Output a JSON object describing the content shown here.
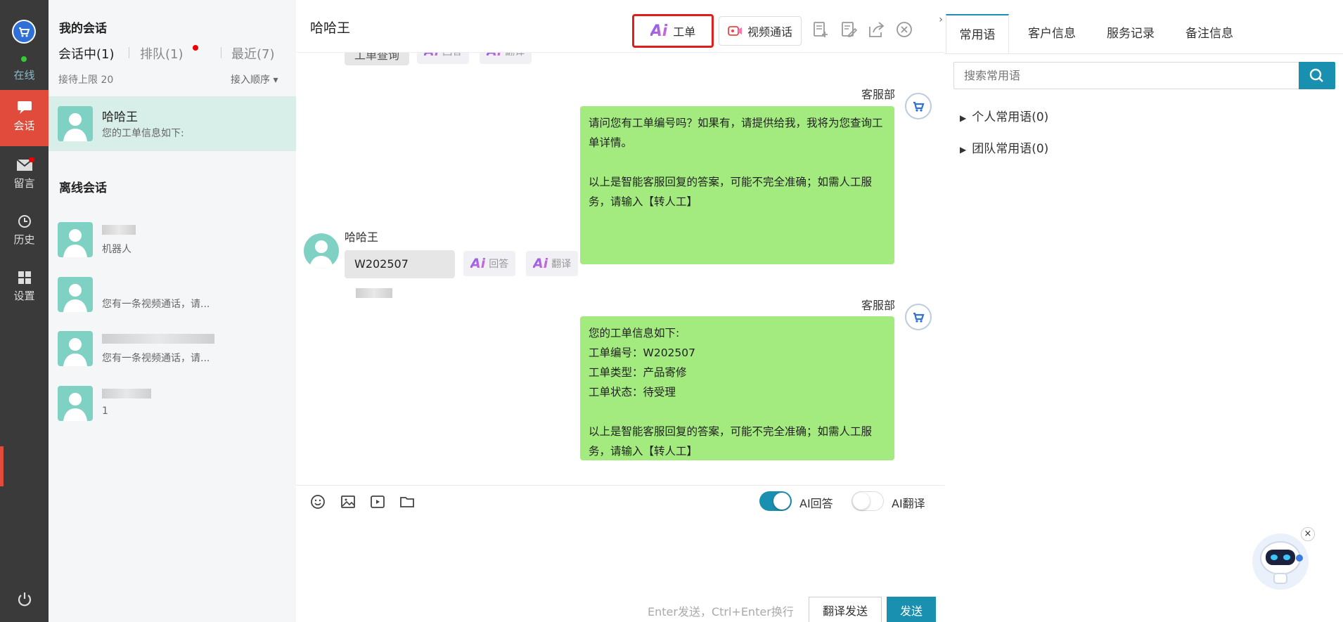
{
  "rail": {
    "status": "在线",
    "items": [
      {
        "label": "会话",
        "icon": "chat-icon"
      },
      {
        "label": "留言",
        "icon": "mail-icon"
      },
      {
        "label": "历史",
        "icon": "clock-icon"
      },
      {
        "label": "设置",
        "icon": "grid-icon"
      }
    ]
  },
  "list": {
    "my_title": "我的会话",
    "tabs": [
      "会话中(1)",
      "排队(1)",
      "最近(7)"
    ],
    "limit": "接待上限 20",
    "order": "接入顺序",
    "active_conv": {
      "name": "哈哈王",
      "msg": "您的工单信息如下:"
    },
    "offline_title": "离线会话",
    "offline": [
      {
        "name": "",
        "msg": "机器人"
      },
      {
        "name": "",
        "msg": "您有一条视频通话，请..."
      },
      {
        "name": "",
        "msg": "您有一条视频通话，请..."
      },
      {
        "name": "",
        "msg": "1"
      }
    ]
  },
  "chat": {
    "title": "哈哈王",
    "workorder_btn": "工单",
    "video_btn": "视频通话",
    "top_partial": {
      "text": "工单查询",
      "btn1": "回答",
      "btn2": "翻译"
    },
    "agent_name": "客服部",
    "msg1": "请问您有工单编号吗？如果有，请提供给我，我将为您查询工单详情。\n\n以上是智能客服回复的答案，可能不完全准确；如需人工服务，请输入【转人工】",
    "user_name": "哈哈王",
    "user_msg": "W202507",
    "ai_answer": "回答",
    "ai_translate": "翻译",
    "msg2": "您的工单信息如下:\n工单编号：W202507\n工单类型：产品寄修\n工单状态：待受理\n\n以上是智能客服回复的答案，可能不完全准确；如需人工服务，请输入【转人工】",
    "toggle_ai_answer": "AI回答",
    "toggle_ai_translate": "AI翻译",
    "hint": "Enter发送，Ctrl+Enter换行",
    "translate_send": "翻译发送",
    "send": "发送"
  },
  "side": {
    "tabs": [
      "常用语",
      "客户信息",
      "服务记录",
      "备注信息"
    ],
    "search_placeholder": "搜索常用语",
    "tree": [
      "个人常用语(0)",
      "团队常用语(0)"
    ]
  },
  "colors": {
    "accent": "#e14b3b",
    "bubble": "#a3ea7f",
    "teal": "#1a90b0",
    "toggle_on": "#1a90b0"
  }
}
